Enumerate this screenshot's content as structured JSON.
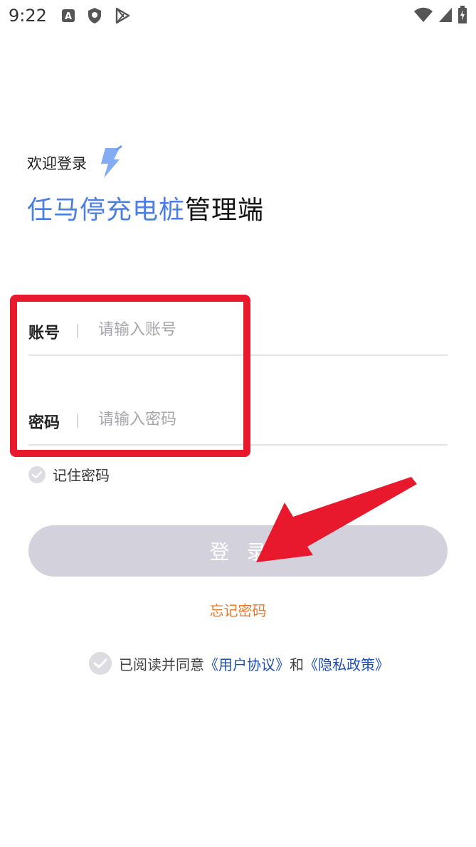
{
  "status_bar": {
    "time": "9:22",
    "icons_left": [
      "text-a-icon",
      "shield-icon",
      "play-store-icon"
    ],
    "icons_right": [
      "wifi-icon",
      "signal-icon",
      "battery-icon"
    ]
  },
  "header": {
    "welcome": "欢迎登录",
    "title_accent": "任马停充电桩",
    "title_rest": "管理端",
    "accent_color": "#4a7fe0"
  },
  "form": {
    "account_label": "账号",
    "account_placeholder": "请输入账号",
    "account_value": "",
    "password_label": "密码",
    "password_placeholder": "请输入密码",
    "password_value": "",
    "remember_label": "记住密码",
    "login_label": "登录",
    "forgot_label": "忘记密码"
  },
  "agreement": {
    "prefix": "已阅读并同意",
    "user_agreement": "《用户协议》",
    "conjunction": "和",
    "privacy_policy": "《隐私政策》"
  },
  "colors": {
    "login_button": "#d2d1dc",
    "forgot_link": "#e8792c",
    "link": "#1f4fb3",
    "annotation": "#e8192c"
  }
}
